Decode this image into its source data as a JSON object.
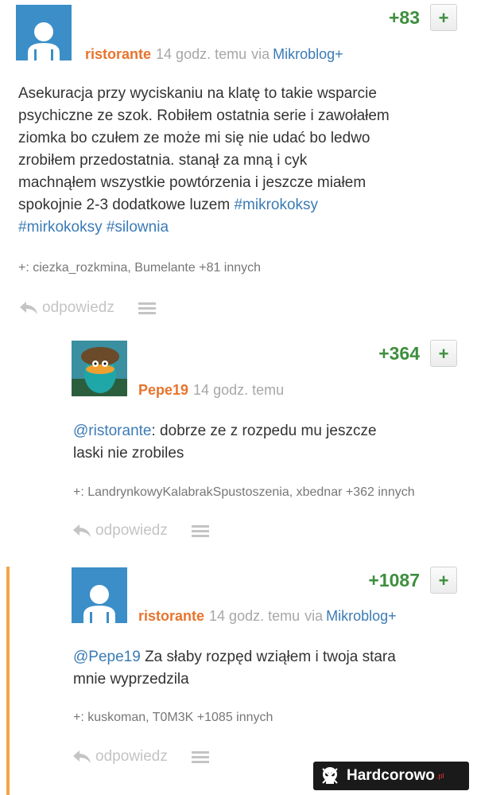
{
  "posts": [
    {
      "author": "ristorante",
      "time": "14 godz. temu",
      "via": "via",
      "source": "Mikroblog+",
      "score": "+83",
      "plus": "+",
      "text_lines": [
        "Asekuracja przy wyciskaniu na klatę to takie wsparcie",
        "psychiczne ze szok. Robiłem ostatnia serie i zawołałem",
        "ziomka bo czułem ze może mi się nie udać bo ledwo",
        "zrobiłem przedostatnia. stanął za mną i cyk",
        "machnąłem wszystkie powtórzenia i jeszcze miałem"
      ],
      "line6_text": "spokojnie 2-3 dodatkowe luzem",
      "tags": [
        "#mikrokoksy",
        "#mirkokoksy",
        "#silownia"
      ],
      "voters": "+: ciezka_rozkmina, Bumelante +81 innych",
      "reply": "odpowiedz"
    },
    {
      "author": "Pepe19",
      "time": "14 godz. temu",
      "score": "+364",
      "plus": "+",
      "mention": "@ristorante",
      "text_after_mention": ": dobrze ze z rozpedu mu jeszcze",
      "text_line2": "laski nie zrobiles",
      "voters": "+: LandrynkowyKalabrakSpustoszenia, xbednar +362 innych",
      "reply": "odpowiedz"
    },
    {
      "author": "ristorante",
      "time": "14 godz. temu",
      "via": "via",
      "source": "Mikroblog+",
      "score": "+1087",
      "plus": "+",
      "mention": "@Pepe19",
      "text_after_mention": " Za słaby rozpęd wziąłem i twoja stara",
      "text_line2": "mnie wyprzedzila",
      "voters": "+: kuskoman, T0M3K +1085 innych",
      "reply": "odpowiedz"
    }
  ],
  "watermark": {
    "text": "Hardcorowo",
    "suffix": ".pl"
  },
  "colors": {
    "author": "#e7742d",
    "score": "#3e8f3e",
    "link": "#3b7bb5",
    "muted": "#a7a7a7",
    "accent_bar": "#f0a648"
  }
}
